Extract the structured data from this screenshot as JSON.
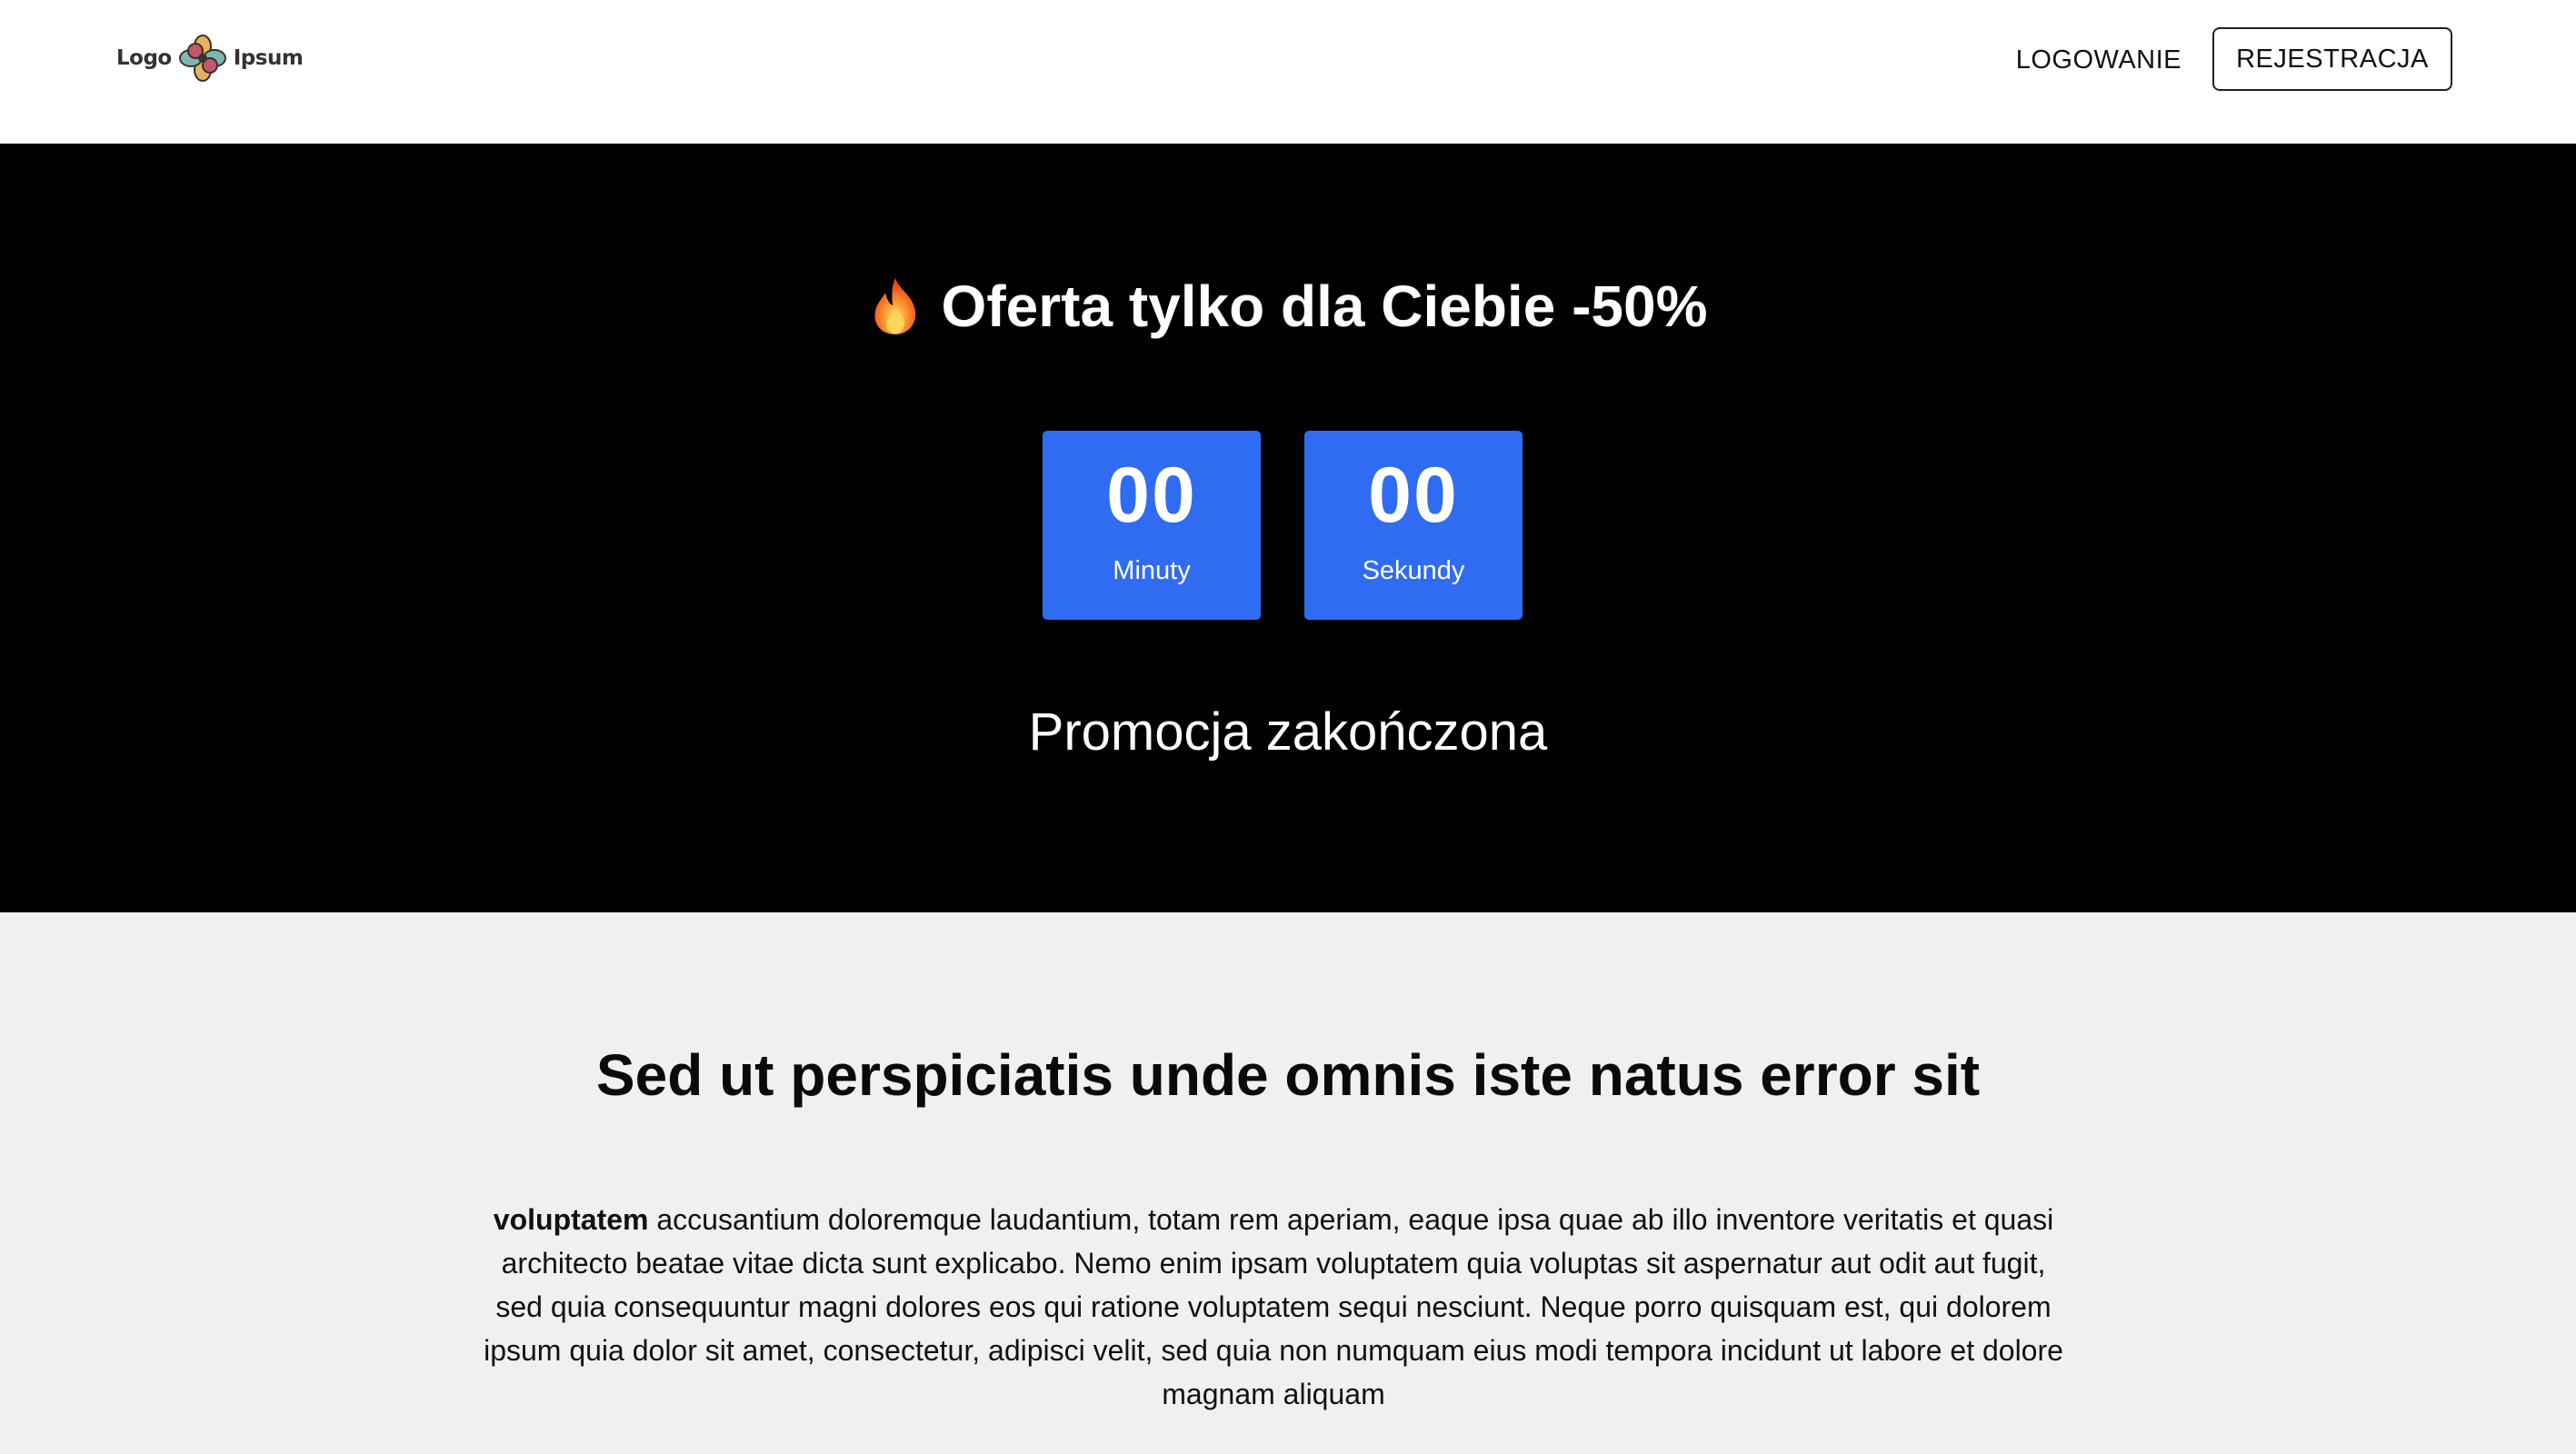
{
  "header": {
    "logo_left": "Logo",
    "logo_right": "Ipsum",
    "login_label": "LOGOWANIE",
    "register_label": "REJESTRACJA"
  },
  "hero": {
    "title": "Oferta tylko dla Ciebie -50%",
    "title_icon": "fire-icon",
    "countdown": [
      {
        "value": "00",
        "label": "Minuty"
      },
      {
        "value": "00",
        "label": "Sekundy"
      }
    ],
    "status": "Promocja zakończona"
  },
  "content": {
    "heading": "Sed ut perspiciatis unde omnis iste natus error sit",
    "body_bold": "voluptatem",
    "body_text": "accusantium doloremque laudantium, totam rem aperiam, eaque ipsa quae ab illo inventore veritatis et quasi architecto beatae vitae dicta sunt explicabo. Nemo enim ipsam voluptatem quia voluptas sit aspernatur aut odit aut fugit, sed quia consequuntur magni dolores eos qui ratione voluptatem sequi nesciunt. Neque porro quisquam est, qui dolorem ipsum quia dolor sit amet, consectetur, adipisci velit, sed quia non numquam eius modi tempora incidunt ut labore et dolore magnam aliquam"
  },
  "colors": {
    "header_bg": "#ffffff",
    "hero_bg": "#000000",
    "countdown_box": "#2f6cf2",
    "content_bg": "#f0f0f0"
  }
}
